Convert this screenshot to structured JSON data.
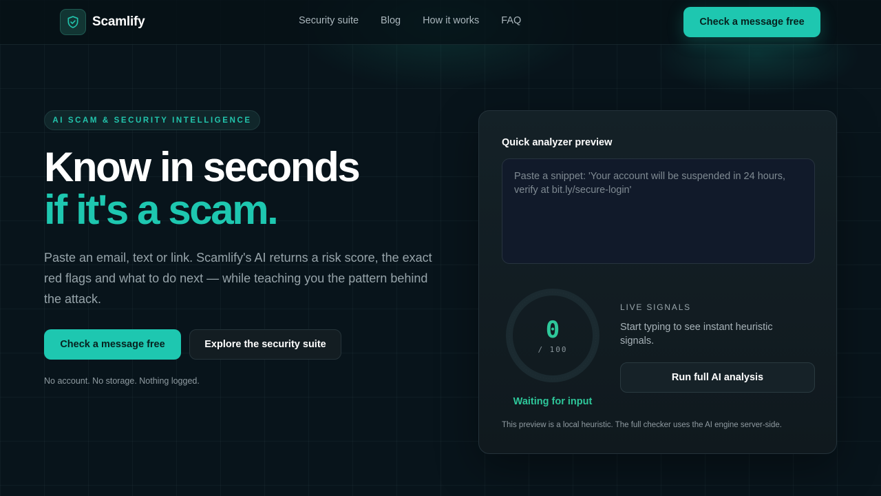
{
  "brand": {
    "name": "Scamlify",
    "logo_icon": "shield-check-icon",
    "accent": "#1ec7b0"
  },
  "nav": {
    "items": [
      {
        "label": "Security suite"
      },
      {
        "label": "Blog"
      },
      {
        "label": "How it works"
      },
      {
        "label": "FAQ"
      }
    ],
    "cta_label": "Check a message free"
  },
  "hero": {
    "eyebrow": "AI SCAM & SECURITY INTELLIGENCE",
    "title_line1": "Know in seconds",
    "title_line2": "if it's a scam.",
    "lead": "Paste an email, text or link. Scamlify's AI returns a risk score, the exact red flags and what to do next — while teaching you the pattern behind the attack.",
    "primary_label": "Check a message free",
    "secondary_label": "Explore the security suite",
    "fine_print": "No account. No storage. Nothing logged."
  },
  "analyzer": {
    "title": "Quick analyzer preview",
    "input_value": "",
    "input_placeholder": "Paste a snippet: 'Your account will be suspended in 24 hours, verify at bit.ly/secure-login'",
    "score": "0",
    "score_max": "/ 100",
    "score_fraction": 0,
    "status": "Waiting for input",
    "signals_heading": "LIVE SIGNALS",
    "signals_text": "Start typing to see instant heuristic signals.",
    "run_label": "Run full AI analysis",
    "note": "This preview is a local heuristic. The full checker uses the AI engine server-side.",
    "status_color": "#2ec79a"
  }
}
